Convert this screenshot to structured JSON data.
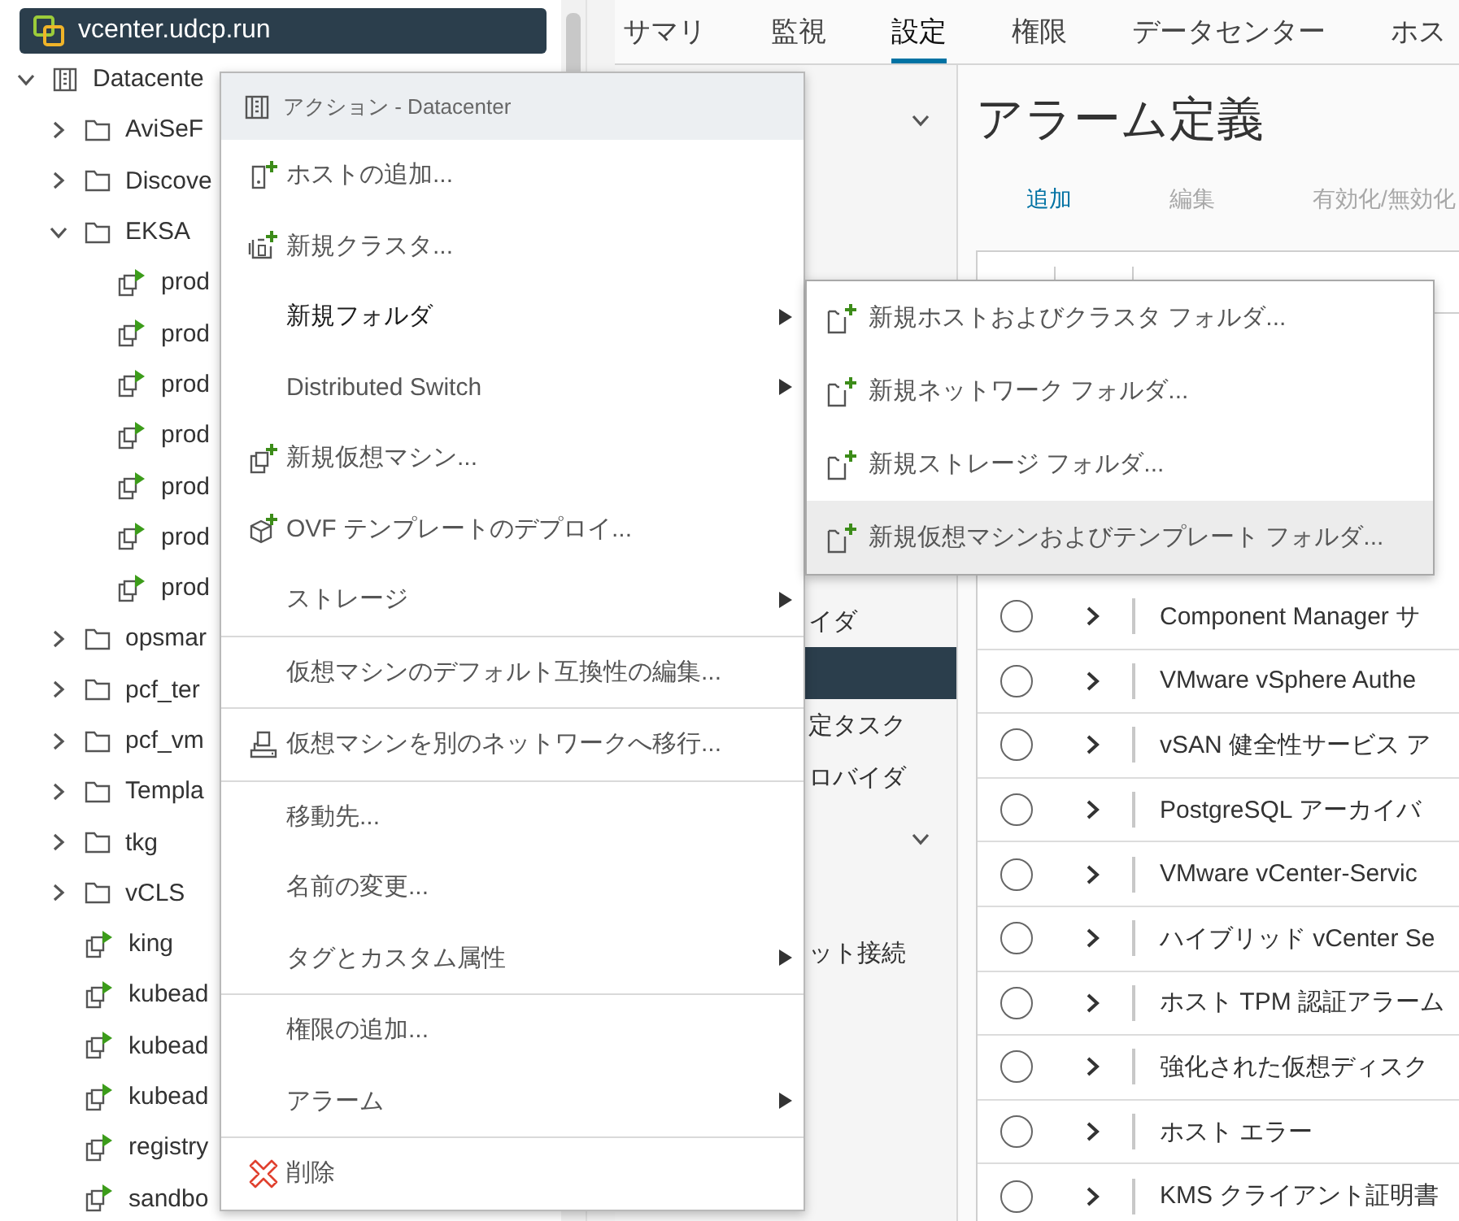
{
  "tree": {
    "root": {
      "label": "vcenter.udcp.run",
      "selected": true,
      "children": [
        {
          "kind": "datacenter",
          "label": "Datacente",
          "expanded": true,
          "children": [
            {
              "kind": "folder",
              "label": "AviSeF",
              "expanded": false
            },
            {
              "kind": "folder",
              "label": "Discove",
              "expanded": false
            },
            {
              "kind": "folder",
              "label": "EKSA",
              "expanded": true,
              "children": [
                {
                  "kind": "vm",
                  "label": "prod",
                  "powered_on": true
                },
                {
                  "kind": "vm",
                  "label": "prod",
                  "powered_on": true
                },
                {
                  "kind": "vm",
                  "label": "prod",
                  "powered_on": true
                },
                {
                  "kind": "vm",
                  "label": "prod",
                  "powered_on": true
                },
                {
                  "kind": "vm",
                  "label": "prod",
                  "powered_on": true
                },
                {
                  "kind": "vm",
                  "label": "prod",
                  "powered_on": true
                },
                {
                  "kind": "vm",
                  "label": "prod",
                  "powered_on": true
                }
              ]
            },
            {
              "kind": "folder",
              "label": "opsmar",
              "expanded": false
            },
            {
              "kind": "folder",
              "label": "pcf_ter",
              "expanded": false
            },
            {
              "kind": "folder",
              "label": "pcf_vm",
              "expanded": false
            },
            {
              "kind": "folder",
              "label": "Templa",
              "expanded": false
            },
            {
              "kind": "folder",
              "label": "tkg",
              "expanded": false
            },
            {
              "kind": "folder",
              "label": "vCLS",
              "expanded": false
            },
            {
              "kind": "vm",
              "label": "king",
              "powered_on": true
            },
            {
              "kind": "vm",
              "label": "kubead",
              "powered_on": true
            },
            {
              "kind": "vm",
              "label": "kubead",
              "powered_on": true
            },
            {
              "kind": "vm",
              "label": "kubead",
              "powered_on": true
            },
            {
              "kind": "vm",
              "label": "registry",
              "powered_on": true
            },
            {
              "kind": "vm",
              "label": "sandbo",
              "powered_on": true
            }
          ]
        }
      ]
    }
  },
  "tabs": [
    {
      "label": "サマリ",
      "selected": false
    },
    {
      "label": "監視",
      "selected": false
    },
    {
      "label": "設定",
      "selected": true
    },
    {
      "label": "権限",
      "selected": false
    },
    {
      "label": "データセンター",
      "selected": false
    },
    {
      "label": "ホス",
      "selected": false
    }
  ],
  "nav": {
    "top_group": {
      "expanded": true
    },
    "items": [
      {
        "kind": "item",
        "label": "イダ",
        "selected": false
      },
      {
        "kind": "item",
        "selected": true
      },
      {
        "kind": "item",
        "label": "定タスク",
        "selected": false
      },
      {
        "kind": "item",
        "label": "ロバイダ",
        "selected": false
      },
      {
        "kind": "group",
        "expanded": true
      },
      {
        "kind": "item",
        "label": "ット接続",
        "selected": false
      }
    ]
  },
  "main": {
    "title": "アラーム定義",
    "toolbar": [
      {
        "label": "追加",
        "disabled": false
      },
      {
        "label": "編集",
        "disabled": true
      },
      {
        "label": "有効化/無効化",
        "disabled": true
      }
    ],
    "rows": [
      {
        "name": "Component Manager サ",
        "selected": false
      },
      {
        "name": "VMware vSphere Authe",
        "selected": false
      },
      {
        "name": "vSAN 健全性サービス ア",
        "selected": false
      },
      {
        "name": "PostgreSQL アーカイバ",
        "selected": false
      },
      {
        "name": "VMware vCenter-Servic",
        "selected": false
      },
      {
        "name": "ハイブリッド vCenter Se",
        "selected": false
      },
      {
        "name": "ホスト TPM 認証アラーム",
        "selected": false
      },
      {
        "name": "強化された仮想ディスク",
        "selected": false
      },
      {
        "name": "ホスト エラー",
        "selected": false
      },
      {
        "name": "KMS クライアント証明書",
        "selected": false
      }
    ]
  },
  "context_menu": {
    "header": "アクション - Datacenter",
    "sections": [
      [
        {
          "kind": "host",
          "label": "ホストの追加...",
          "submenu": false
        },
        {
          "kind": "cluster",
          "label": "新規クラスタ...",
          "submenu": false
        },
        {
          "kind": "plain",
          "label": "新規フォルダ",
          "submenu": true,
          "expanded": true
        },
        {
          "kind": "plain",
          "label": "Distributed Switch",
          "submenu": true,
          "expanded": false
        },
        {
          "kind": "vm",
          "label": "新規仮想マシン...",
          "submenu": false
        },
        {
          "kind": "ovf",
          "label": "OVF テンプレートのデプロイ...",
          "submenu": false
        },
        {
          "kind": "plain",
          "label": "ストレージ",
          "submenu": true,
          "expanded": false
        }
      ],
      [
        {
          "kind": "plain",
          "label": "仮想マシンのデフォルト互換性の編集...",
          "submenu": false
        }
      ],
      [
        {
          "kind": "migrate",
          "label": "仮想マシンを別のネットワークへ移行...",
          "submenu": false
        }
      ],
      [
        {
          "kind": "plain",
          "label": "移動先...",
          "submenu": false
        },
        {
          "kind": "plain",
          "label": "名前の変更...",
          "submenu": false
        },
        {
          "kind": "plain",
          "label": "タグとカスタム属性",
          "submenu": true,
          "expanded": false
        }
      ],
      [
        {
          "kind": "plain",
          "label": "権限の追加...",
          "submenu": false
        },
        {
          "kind": "plain",
          "label": "アラーム",
          "submenu": true,
          "expanded": false
        }
      ],
      [
        {
          "kind": "delete",
          "label": "削除",
          "submenu": false
        }
      ]
    ]
  },
  "submenu": {
    "items": [
      {
        "label": "新規ホストおよびクラスタ フォルダ...",
        "selected": false
      },
      {
        "label": "新規ネットワーク フォルダ...",
        "selected": false
      },
      {
        "label": "新規ストレージ フォルダ...",
        "selected": false
      },
      {
        "label": "新規仮想マシンおよびテンプレート フォルダ...",
        "selected": true
      }
    ]
  }
}
